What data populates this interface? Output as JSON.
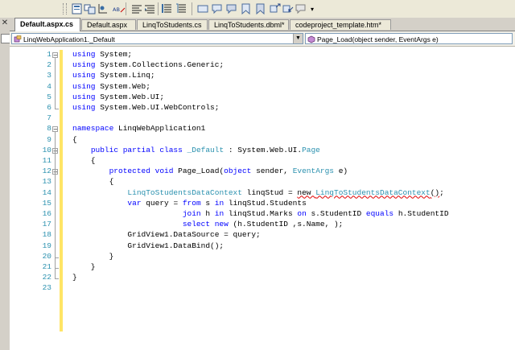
{
  "toolbar": {
    "buttons": [
      "toolbar-button-1",
      "toolbar-button-2",
      "toolbar-button-3",
      "toolbar-button-4",
      "toolbar-button-5",
      "toolbar-button-6",
      "toolbar-button-7",
      "toolbar-button-8",
      "toolbar-button-9",
      "toolbar-button-10",
      "toolbar-button-11",
      "toolbar-button-12",
      "toolbar-button-13",
      "toolbar-button-14",
      "toolbar-button-15",
      "toolbar-button-16",
      "toolbar-button-17"
    ],
    "abc_label": "ABC",
    "overflow": "▾"
  },
  "tabs": [
    {
      "label": "Default.aspx.cs",
      "active": true
    },
    {
      "label": "Default.aspx",
      "active": false
    },
    {
      "label": "LinqToStudents.cs",
      "active": false
    },
    {
      "label": "LinqToStudents.dbml*",
      "active": false
    },
    {
      "label": "codeproject_template.htm*",
      "active": false
    }
  ],
  "navbar": {
    "class_dropdown": "LinqWebApplication1._Default",
    "member_dropdown": "Page_Load(object sender, EventArgs e)"
  },
  "editor": {
    "line_numbers": [
      "1",
      "2",
      "3",
      "4",
      "5",
      "6",
      "7",
      "8",
      "9",
      "10",
      "11",
      "12",
      "13",
      "14",
      "15",
      "16",
      "17",
      "18",
      "19",
      "20",
      "21",
      "22",
      "23"
    ],
    "lines": [
      [
        [
          "k",
          "using"
        ],
        [
          "t",
          " System;"
        ]
      ],
      [
        [
          "k",
          "using"
        ],
        [
          "t",
          " System.Collections.Generic;"
        ]
      ],
      [
        [
          "k",
          "using"
        ],
        [
          "t",
          " System.Linq;"
        ]
      ],
      [
        [
          "k",
          "using"
        ],
        [
          "t",
          " System.Web;"
        ]
      ],
      [
        [
          "k",
          "using"
        ],
        [
          "t",
          " System.Web.UI;"
        ]
      ],
      [
        [
          "k",
          "using"
        ],
        [
          "t",
          " System.Web.UI.WebControls;"
        ]
      ],
      [],
      [
        [
          "k",
          "namespace"
        ],
        [
          "t",
          " LinqWebApplication1"
        ]
      ],
      [
        [
          "t",
          "{"
        ]
      ],
      [
        [
          "t",
          "    "
        ],
        [
          "k",
          "public partial class"
        ],
        [
          "t",
          " "
        ],
        [
          "y",
          "_Default"
        ],
        [
          "t",
          " : System.Web.UI."
        ],
        [
          "y",
          "Page"
        ]
      ],
      [
        [
          "t",
          "    {"
        ]
      ],
      [
        [
          "t",
          "        "
        ],
        [
          "k",
          "protected void"
        ],
        [
          "t",
          " Page_Load("
        ],
        [
          "k",
          "object"
        ],
        [
          "t",
          " sender, "
        ],
        [
          "y",
          "EventArgs"
        ],
        [
          "t",
          " e)"
        ]
      ],
      [
        [
          "t",
          "        {"
        ]
      ],
      [
        [
          "t",
          "            "
        ],
        [
          "y",
          "LinqToStudentsDataContext"
        ],
        [
          "t",
          " linqStud = "
        ],
        [
          "s",
          "new "
        ],
        [
          "sy",
          "LinqToStudentsDataContext"
        ],
        [
          "s",
          "()"
        ],
        [
          "t",
          ";"
        ]
      ],
      [
        [
          "t",
          "            "
        ],
        [
          "k",
          "var"
        ],
        [
          "t",
          " query = "
        ],
        [
          "k",
          "from"
        ],
        [
          "t",
          " s "
        ],
        [
          "k",
          "in"
        ],
        [
          "t",
          " linqStud.Students"
        ]
      ],
      [
        [
          "t",
          "                        "
        ],
        [
          "k",
          "join"
        ],
        [
          "t",
          " h "
        ],
        [
          "k",
          "in"
        ],
        [
          "t",
          " linqStud.Marks "
        ],
        [
          "k",
          "on"
        ],
        [
          "t",
          " s.StudentID "
        ],
        [
          "k",
          "equals"
        ],
        [
          "t",
          " h.StudentID"
        ]
      ],
      [
        [
          "t",
          "                        "
        ],
        [
          "k",
          "select new"
        ],
        [
          "t",
          " (h.StudentID ,s.Name, );"
        ]
      ],
      [
        [
          "t",
          "            GridView1.DataSource = query;"
        ]
      ],
      [
        [
          "t",
          "            GridView1.DataBind();"
        ]
      ],
      [
        [
          "t",
          "        }"
        ]
      ],
      [
        [
          "t",
          "    }"
        ]
      ],
      [
        [
          "t",
          "}"
        ]
      ],
      []
    ]
  }
}
